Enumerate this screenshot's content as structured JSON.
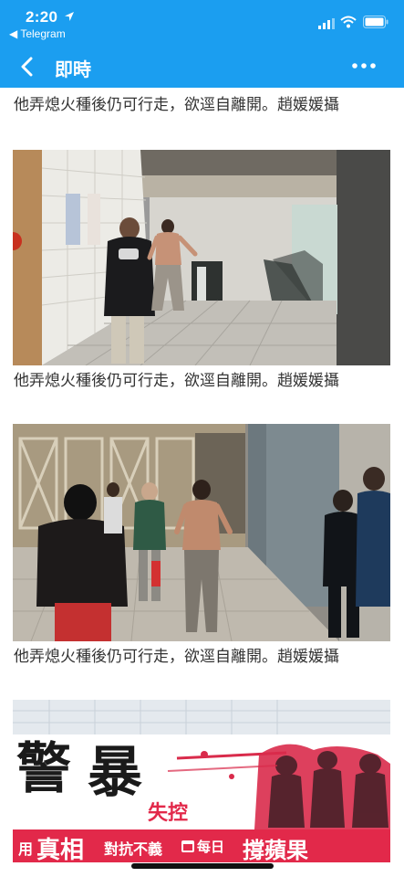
{
  "status_bar": {
    "time": "2:20",
    "back_app": "◀ Telegram"
  },
  "nav": {
    "title": "即時"
  },
  "captions": [
    "他弄熄火種後仍可行走，欲逕自離開。趙媛媛攝",
    "他弄熄火種後仍可行走，欲逕自離開。趙媛媛攝",
    "他弄熄火種後仍可行走，欲逕自離開。趙媛媛攝"
  ],
  "ad": {
    "headline_1": "警",
    "headline_2": "暴",
    "subhead": "失控",
    "tagline_prefix": "用",
    "tagline_big": "真相",
    "tagline_mid": "對抗不義",
    "brand_prefix": "每日",
    "brand_big": "撐蘋果"
  },
  "colors": {
    "accent": "#1b9ef0",
    "ad_red": "#e2294a"
  }
}
